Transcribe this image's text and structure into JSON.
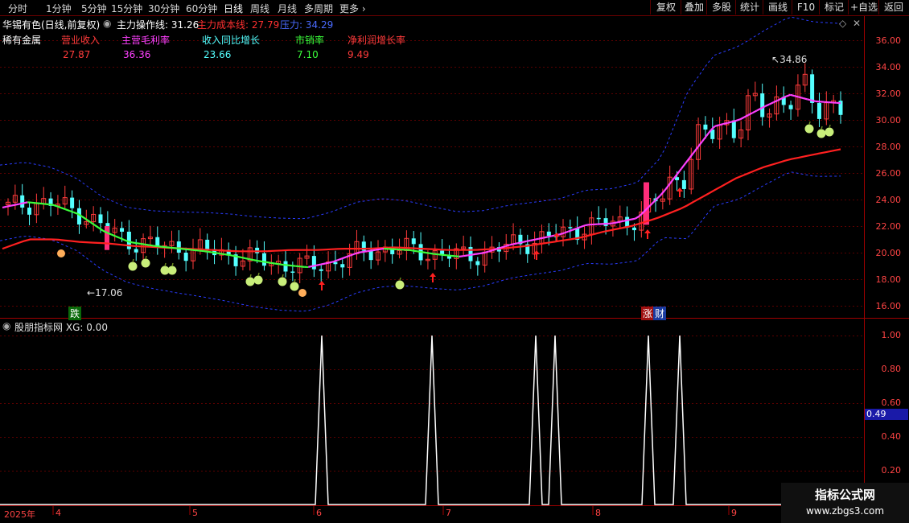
{
  "toolbar": {
    "periods": [
      "分时",
      "1分钟",
      "5分钟",
      "15分钟",
      "30分钟",
      "60分钟",
      "日线",
      "周线",
      "月线",
      "多周期",
      "更多"
    ],
    "active_period": "日线",
    "right_buttons": [
      "复权",
      "叠加",
      "多股",
      "统计",
      "画线",
      "F10",
      "标记",
      "+自选",
      "返回"
    ]
  },
  "main_panel": {
    "stock_title": "华锡有色(日线,前复权)",
    "indicator_name": "主力操作线",
    "indicator_value": "31.26",
    "cost_line_label": "主力成本线:",
    "cost_line_value": "27.79",
    "pressure_label": "压力:",
    "pressure_value": "34.29",
    "sector": "稀有金属",
    "fin_labels": [
      "营业收入",
      "主营毛利率",
      "收入同比增长",
      "市销率",
      "净利润增长率"
    ],
    "fin_values": [
      "27.87",
      "36.36",
      "23.66",
      "7.10",
      "9.49"
    ],
    "high_label": "34.86",
    "low_label": "17.06",
    "tag_down": "跌",
    "tag_up": "涨",
    "tag_cai": "财",
    "y_axis": [
      "36.00",
      "34.00",
      "32.00",
      "30.00",
      "28.00",
      "26.00",
      "24.00",
      "22.00",
      "20.00",
      "18.00",
      "16.00"
    ]
  },
  "sub_panel": {
    "title": "股朋指标网",
    "xg_label": "XG:",
    "xg_value": "0.00",
    "y_axis": [
      "1.00",
      "0.80",
      "0.60",
      "0.40",
      "0.20"
    ],
    "current_value": "0.49"
  },
  "date_axis": [
    "2025年",
    "4",
    "5",
    "6",
    "7",
    "8",
    "9"
  ],
  "watermark": {
    "title": "指标公式网",
    "url": "www.zbgs3.com"
  },
  "colors": {
    "up": "#ff3b3b",
    "down": "#54ffff",
    "main_line": "#ff40ff",
    "cost_line": "#ff2020",
    "grid": "#8b0000",
    "signal": "#ffffff"
  },
  "chart_data": [
    {
      "type": "line",
      "title": "华锡有色(日线,前复权)",
      "ylim": [
        15.5,
        37
      ],
      "series": [
        {
          "name": "主力操作线",
          "values": [
            23.4,
            23.8,
            23.6,
            22.9,
            21.6,
            20.8,
            20.5,
            20.3,
            20.1,
            19.8,
            19.4,
            19.1,
            18.9,
            19.3,
            20.0,
            20.3,
            20.2,
            19.9,
            19.7,
            20.0,
            20.6,
            21.0,
            21.4,
            22.1,
            22.2,
            22.6,
            24.5,
            27.0,
            29.5,
            30.0,
            31.0,
            31.9,
            31.4,
            31.26
          ]
        },
        {
          "name": "主力成本线",
          "values": [
            20.3,
            21.0,
            21.0,
            20.8,
            20.7,
            20.5,
            20.4,
            20.3,
            20.2,
            20.1,
            20.1,
            20.2,
            20.2,
            20.3,
            20.3,
            20.4,
            20.3,
            20.2,
            20.2,
            20.3,
            20.5,
            20.8,
            21.1,
            21.6,
            22.0,
            22.6,
            23.4,
            24.5,
            25.6,
            26.4,
            27.0,
            27.4,
            27.79
          ]
        }
      ]
    },
    {
      "type": "line",
      "title": "股朋指标网",
      "ylim": [
        0,
        1.1
      ],
      "series": [
        {
          "name": "XG",
          "values": [
            0,
            1,
            0,
            1,
            0,
            1,
            1,
            0,
            1,
            1,
            0
          ]
        }
      ]
    }
  ]
}
